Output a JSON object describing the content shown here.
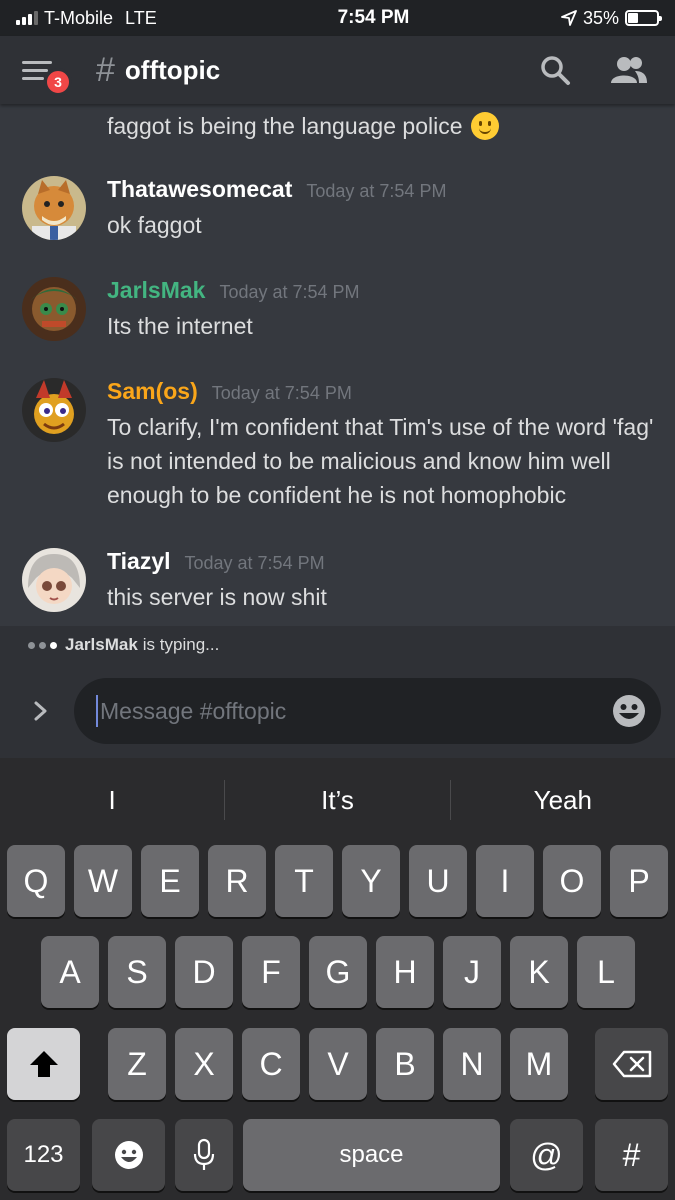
{
  "status_bar": {
    "carrier": "T-Mobile",
    "network": "LTE",
    "time": "7:54 PM",
    "battery": "35%",
    "battery_level": 0.35
  },
  "header": {
    "channel_name": "offtopic",
    "notification_count": "3",
    "icons": [
      "menu-icon",
      "search-icon",
      "members-icon"
    ]
  },
  "messages": {
    "continuation": "faggot is being the language police",
    "items": [
      {
        "author": "Thatawesomecat",
        "timestamp": "Today at 7:54 PM",
        "text": "ok faggot",
        "color": "#ffffff"
      },
      {
        "author": "JarlsMak",
        "timestamp": "Today at 7:54 PM",
        "text": "Its the internet",
        "color": "#43b581"
      },
      {
        "author": "Sam(os)",
        "timestamp": "Today at 7:54 PM",
        "text": "To clarify, I'm confident that Tim's use of the word 'fag' is not intended to be malicious and know him well enough to be confident he is not homophobic",
        "color": "#faa61a"
      },
      {
        "author": "Tiazyl",
        "timestamp": "Today at 7:54 PM",
        "text": "this server is now shit",
        "color": "#ffffff"
      }
    ]
  },
  "typing": {
    "user": "JarlsMak",
    "suffix": "is typing..."
  },
  "composer": {
    "placeholder": "Message #offtopic"
  },
  "keyboard": {
    "suggestions": [
      "I",
      "It’s",
      "Yeah"
    ],
    "row1": [
      "Q",
      "W",
      "E",
      "R",
      "T",
      "Y",
      "U",
      "I",
      "O",
      "P"
    ],
    "row2": [
      "A",
      "S",
      "D",
      "F",
      "G",
      "H",
      "J",
      "K",
      "L"
    ],
    "row3": [
      "Z",
      "X",
      "C",
      "V",
      "B",
      "N",
      "M"
    ],
    "numbers_label": "123",
    "space_label": "space",
    "at_label": "@",
    "hash_label": "#"
  },
  "colors": {
    "background": "#36393f",
    "header": "#2f3136",
    "badge": "#f04747",
    "accent": "#7289da"
  }
}
